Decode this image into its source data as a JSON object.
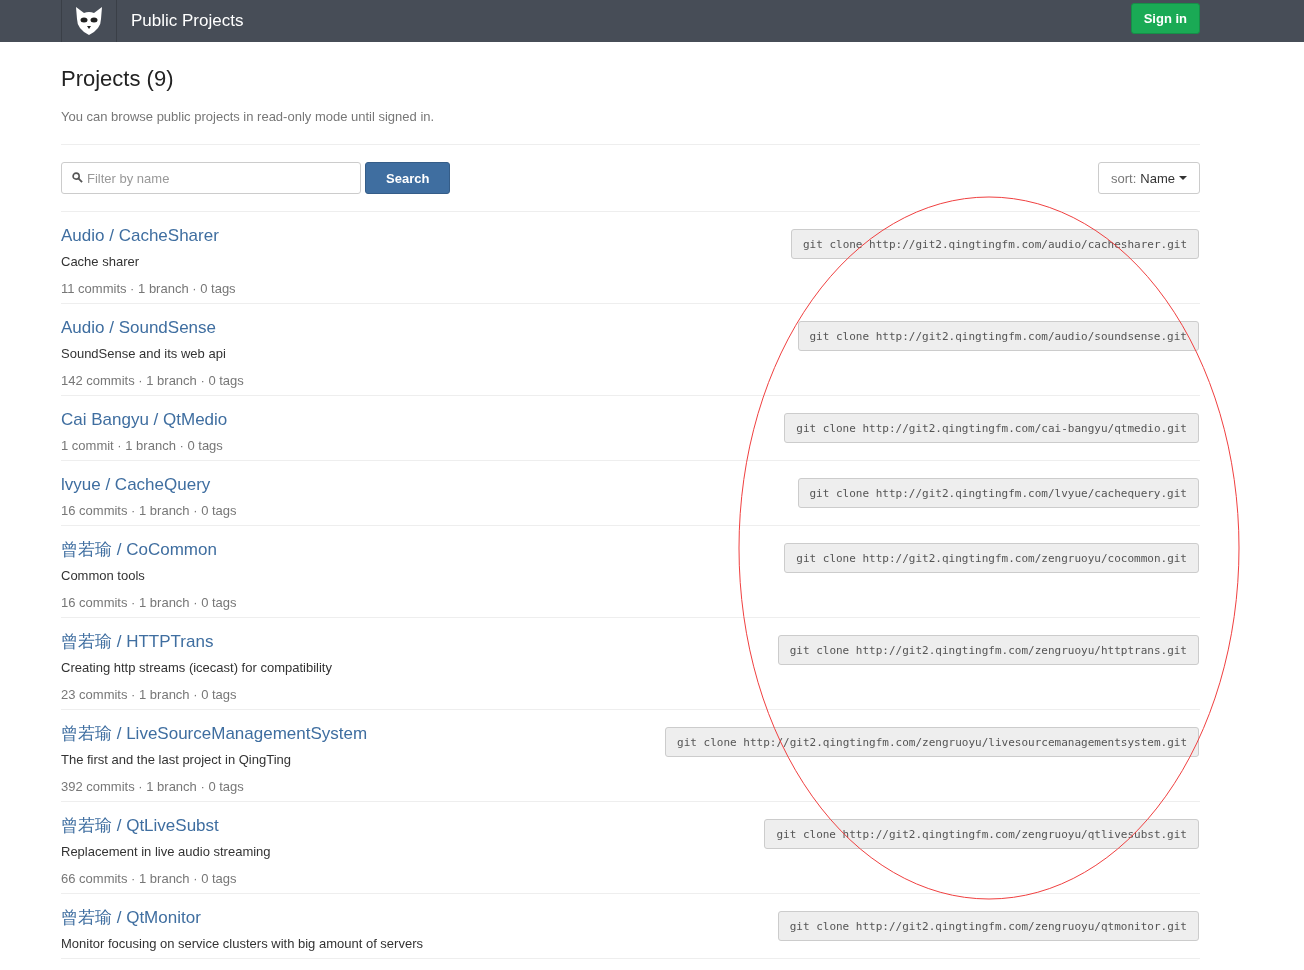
{
  "navbar": {
    "title": "Public Projects",
    "sign_in": "Sign in"
  },
  "header": {
    "title": "Projects (9)",
    "subtitle": "You can browse public projects in read-only mode until signed in."
  },
  "filter": {
    "placeholder": "Filter by name",
    "search_button": "Search",
    "sort_label": "sort:",
    "sort_value": "Name"
  },
  "projects": [
    {
      "title": "Audio / CacheSharer",
      "description": "Cache sharer",
      "stats": "11 commits · 1 branch · 0 tags",
      "clone": "git clone http://git2.qingtingfm.com/audio/cachesharer.git"
    },
    {
      "title": "Audio / SoundSense",
      "description": "SoundSense and its web api",
      "stats": "142 commits · 1 branch · 0 tags",
      "clone": "git clone http://git2.qingtingfm.com/audio/soundsense.git"
    },
    {
      "title": "Cai Bangyu / QtMedio",
      "stats": "1 commit · 1 branch · 0 tags",
      "clone": "git clone http://git2.qingtingfm.com/cai-bangyu/qtmedio.git"
    },
    {
      "title": "lvyue / CacheQuery",
      "stats": "16 commits · 1 branch · 0 tags",
      "clone": "git clone http://git2.qingtingfm.com/lvyue/cachequery.git"
    },
    {
      "title": "曾若瑜 / CoCommon",
      "description": "Common tools",
      "stats": "16 commits · 1 branch · 0 tags",
      "clone": "git clone http://git2.qingtingfm.com/zengruoyu/cocommon.git"
    },
    {
      "title": "曾若瑜 / HTTPTrans",
      "description": "Creating http streams (icecast) for compatibility",
      "stats": "23 commits · 1 branch · 0 tags",
      "clone": "git clone http://git2.qingtingfm.com/zengruoyu/httptrans.git"
    },
    {
      "title": "曾若瑜 / LiveSourceManagementSystem",
      "description": "The first and the last project in QingTing",
      "stats": "392 commits · 1 branch · 0 tags",
      "clone": "git clone http://git2.qingtingfm.com/zengruoyu/livesourcemanagementsystem.git"
    },
    {
      "title": "曾若瑜 / QtLiveSubst",
      "description": "Replacement in live audio streaming",
      "stats": "66 commits · 1 branch · 0 tags",
      "clone": "git clone http://git2.qingtingfm.com/zengruoyu/qtlivesubst.git"
    },
    {
      "title": "曾若瑜 / QtMonitor",
      "description": "Monitor focusing on service clusters with big amount of servers",
      "clone": "git clone http://git2.qingtingfm.com/zengruoyu/qtmonitor.git"
    }
  ]
}
